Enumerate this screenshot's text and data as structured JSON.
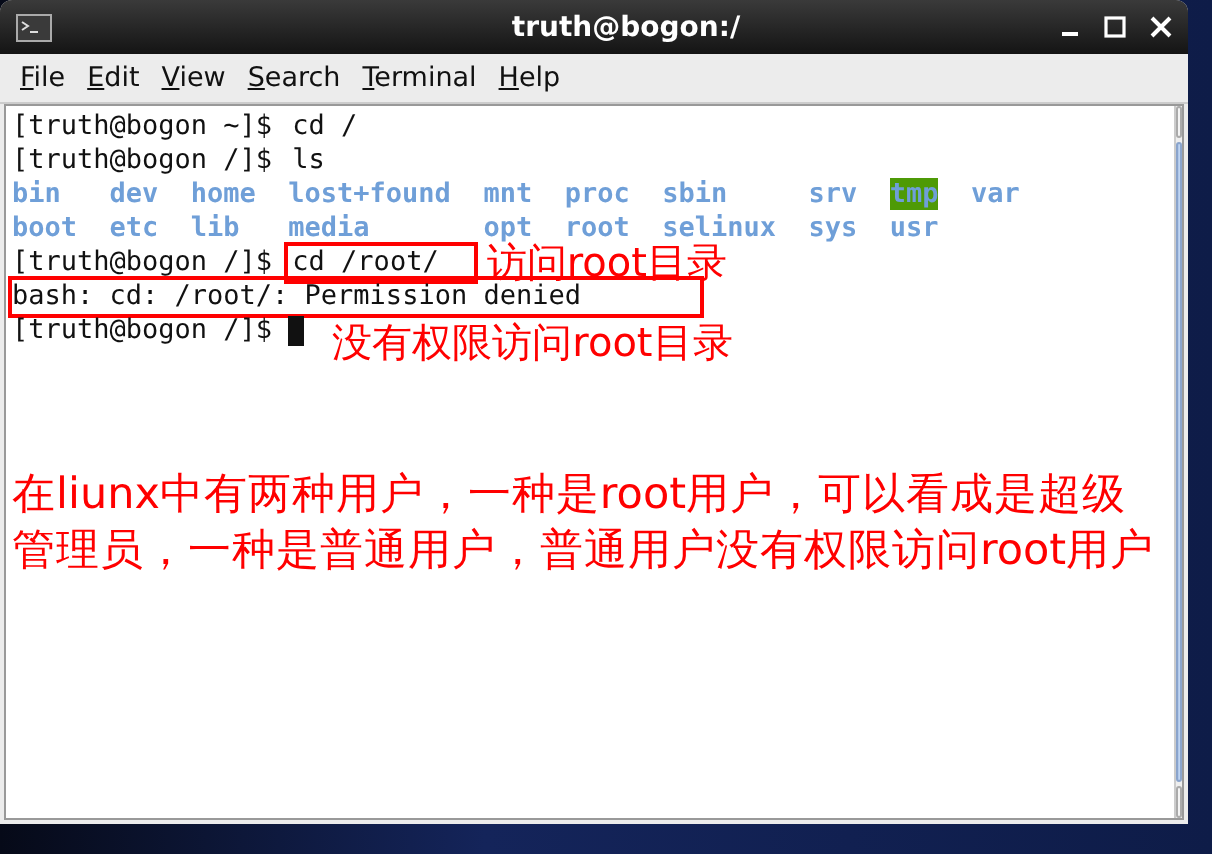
{
  "window": {
    "title": "truth@bogon:/"
  },
  "menu": [
    {
      "label": "File"
    },
    {
      "label": "Edit"
    },
    {
      "label": "View"
    },
    {
      "label": "Search"
    },
    {
      "label": "Terminal"
    },
    {
      "label": "Help"
    }
  ],
  "terminal": {
    "lines": [
      {
        "kind": "prompt",
        "prompt": "[truth@bogon ~]$",
        "command": "cd /"
      },
      {
        "kind": "prompt",
        "prompt": "[truth@bogon /]$",
        "command": "ls"
      },
      {
        "kind": "listing",
        "entries": [
          {
            "name": "bin",
            "highlighted": false
          },
          {
            "name": "dev",
            "highlighted": false
          },
          {
            "name": "home",
            "highlighted": false
          },
          {
            "name": "lost+found",
            "highlighted": false
          },
          {
            "name": "mnt",
            "highlighted": false
          },
          {
            "name": "proc",
            "highlighted": false
          },
          {
            "name": "sbin",
            "highlighted": false
          },
          {
            "name": "srv",
            "highlighted": false
          },
          {
            "name": "tmp",
            "highlighted": true
          },
          {
            "name": "var",
            "highlighted": false
          }
        ]
      },
      {
        "kind": "listing",
        "entries": [
          {
            "name": "boot",
            "highlighted": false
          },
          {
            "name": "etc",
            "highlighted": false
          },
          {
            "name": "lib",
            "highlighted": false
          },
          {
            "name": "media",
            "highlighted": false
          },
          {
            "name": "opt",
            "highlighted": false
          },
          {
            "name": "root",
            "highlighted": false
          },
          {
            "name": "selinux",
            "highlighted": false
          },
          {
            "name": "sys",
            "highlighted": false
          },
          {
            "name": "usr",
            "highlighted": false
          }
        ]
      },
      {
        "kind": "prompt",
        "prompt": "[truth@bogon /]$",
        "command": "cd /root/",
        "boxed": true,
        "note": "访问root目录"
      },
      {
        "kind": "output",
        "text": "bash: cd: /root/: Permission denied",
        "boxed": true
      },
      {
        "kind": "prompt",
        "prompt": "[truth@bogon /]$",
        "cursor": true,
        "note": "没有权限访问root目录"
      }
    ],
    "explanation": "在liunx中有两种用户，一种是root用户，可以看成是超级管理员，一种是普通用户，普通用户没有权限访问root用户"
  }
}
